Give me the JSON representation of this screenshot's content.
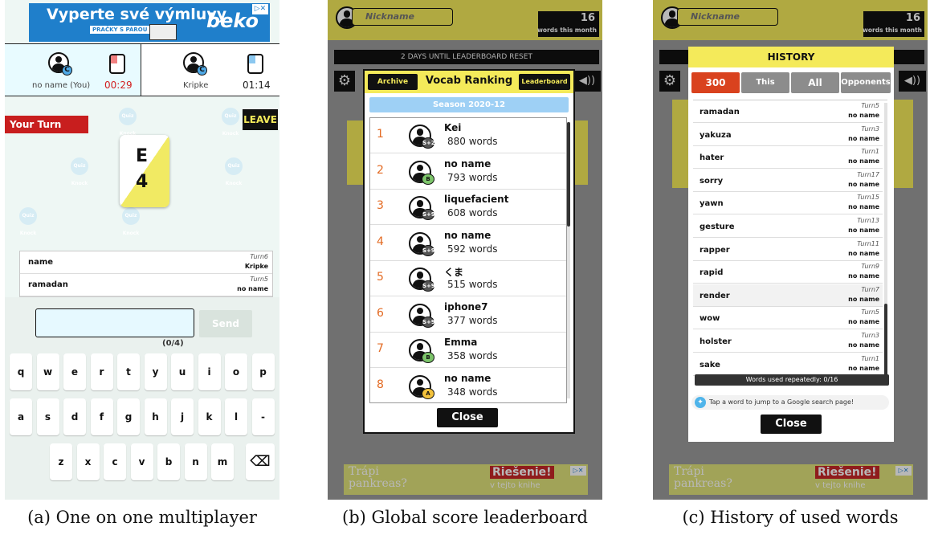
{
  "screen1": {
    "ad": {
      "headline": "Vyperte své výmluvy",
      "tag": "PRAČKY S PÁROU",
      "brand": "beko",
      "close": "▷✕"
    },
    "me": {
      "name": "no name (You)",
      "badge": "C",
      "time": "00:29"
    },
    "opponent": {
      "name": "Kripke",
      "badge": "C",
      "time": "01:14"
    },
    "your_turn": "Your Turn",
    "leave": "LEAVE",
    "card": {
      "letter": "E",
      "number": "4"
    },
    "deco_text": "Quiz Knock",
    "words": [
      {
        "word": "name",
        "turn": "Turn6",
        "who": "Kripke"
      },
      {
        "word": "ramadan",
        "turn": "Turn5",
        "who": "no name"
      }
    ],
    "input": {
      "value": "",
      "placeholder": ""
    },
    "send": "Send",
    "counter": "(0/4)",
    "keys_row1": [
      "q",
      "w",
      "e",
      "r",
      "t",
      "y",
      "u",
      "i",
      "o",
      "p"
    ],
    "keys_row2": [
      "a",
      "s",
      "d",
      "f",
      "g",
      "h",
      "j",
      "k",
      "l",
      "-"
    ],
    "keys_row3": [
      "z",
      "x",
      "c",
      "v",
      "b",
      "n",
      "m"
    ],
    "backspace": "⌫"
  },
  "screen2": {
    "nickname": "Nickname",
    "count": "16",
    "count_label": "words this month",
    "reset": "2 DAYS UNTIL LEADERBOARD RESET",
    "archive": "Archive",
    "title": "Vocab Ranking",
    "leaderboard": "Leaderboard",
    "season": "Season 2020-12",
    "rankings": [
      {
        "rank": "1",
        "name": "Kei",
        "words": "880 words",
        "badge": "S+2"
      },
      {
        "rank": "2",
        "name": "no name",
        "words": "793 words",
        "badge": "B"
      },
      {
        "rank": "3",
        "name": "liquefacient",
        "words": "608 words",
        "badge": "S+9"
      },
      {
        "rank": "4",
        "name": "no name",
        "words": "592 words",
        "badge": "S+9"
      },
      {
        "rank": "5",
        "name": "くま",
        "words": "515 words",
        "badge": "S+9"
      },
      {
        "rank": "6",
        "name": "iphone7",
        "words": "377 words",
        "badge": "S+9"
      },
      {
        "rank": "7",
        "name": "Emma",
        "words": "358 words",
        "badge": "B"
      },
      {
        "rank": "8",
        "name": "no name",
        "words": "348 words",
        "badge": "A"
      }
    ],
    "close": "Close",
    "ad": {
      "line1": "Trápi",
      "line2": "pankreas?",
      "line3": "Riešenie!",
      "line4": "v tejto knihe",
      "close": "▷✕"
    }
  },
  "screen3": {
    "nickname": "Nickname",
    "count": "16",
    "count_label": "words this month",
    "title": "HISTORY",
    "tabs": [
      "300",
      "This Month",
      "All",
      "Opponents"
    ],
    "history": [
      {
        "word": "ramadan",
        "turn": "Turn5",
        "who": "no name"
      },
      {
        "word": "yakuza",
        "turn": "Turn3",
        "who": "no name"
      },
      {
        "word": "hater",
        "turn": "Turn1",
        "who": "no name"
      },
      {
        "word": "sorry",
        "turn": "Turn17",
        "who": "no name"
      },
      {
        "word": "yawn",
        "turn": "Turn15",
        "who": "no name"
      },
      {
        "word": "gesture",
        "turn": "Turn13",
        "who": "no name"
      },
      {
        "word": "rapper",
        "turn": "Turn11",
        "who": "no name"
      },
      {
        "word": "rapid",
        "turn": "Turn9",
        "who": "no name"
      },
      {
        "word": "render",
        "turn": "Turn7",
        "who": "no name"
      },
      {
        "word": "wow",
        "turn": "Turn5",
        "who": "no name"
      },
      {
        "word": "holster",
        "turn": "Turn3",
        "who": "no name"
      },
      {
        "word": "sake",
        "turn": "Turn1",
        "who": "no name"
      }
    ],
    "repeat": "Words used repeatedly: 0/16",
    "tip": "Tap a word to jump to a Google search page!",
    "close": "Close",
    "ad": {
      "line1": "Trápi",
      "line2": "pankreas?",
      "line3": "Riešenie!",
      "line4": "v tejto knihe",
      "close": "▷✕"
    }
  },
  "captions": [
    "(a) One on one multiplayer",
    "(b) Global score leaderboard",
    "(c) History of used words"
  ]
}
